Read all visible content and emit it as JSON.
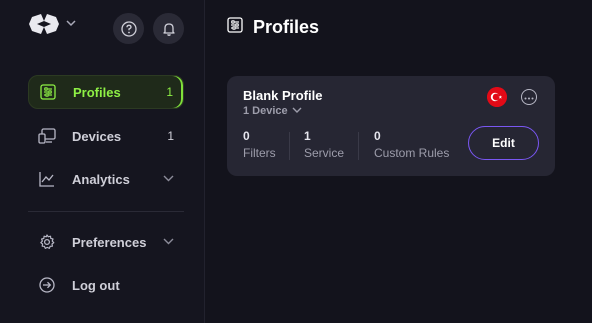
{
  "sidebar": {
    "logo_icon": "logo-icon",
    "help_icon": "question-icon",
    "notifications_icon": "bell-icon",
    "items": [
      {
        "label": "Profiles",
        "count": "1",
        "icon": "profiles-icon",
        "active": true
      },
      {
        "label": "Devices",
        "count": "1",
        "icon": "devices-icon"
      },
      {
        "label": "Analytics",
        "icon": "analytics-icon"
      },
      {
        "label": "Preferences",
        "icon": "gear-icon"
      },
      {
        "label": "Log out",
        "icon": "logout-icon"
      }
    ]
  },
  "main": {
    "title": "Profiles",
    "title_icon": "profiles-icon",
    "card": {
      "name": "Blank Profile",
      "device": "1 Device",
      "flag": "turkey-flag",
      "stats": [
        {
          "value": "0",
          "label": "Filters"
        },
        {
          "value": "1",
          "label": "Service"
        },
        {
          "value": "0",
          "label": "Custom Rules"
        }
      ],
      "edit_label": "Edit"
    }
  },
  "colors": {
    "accent_green": "#8ef045",
    "edit_border": "#7a57f3",
    "background": "#13131c",
    "card": "#262633"
  }
}
